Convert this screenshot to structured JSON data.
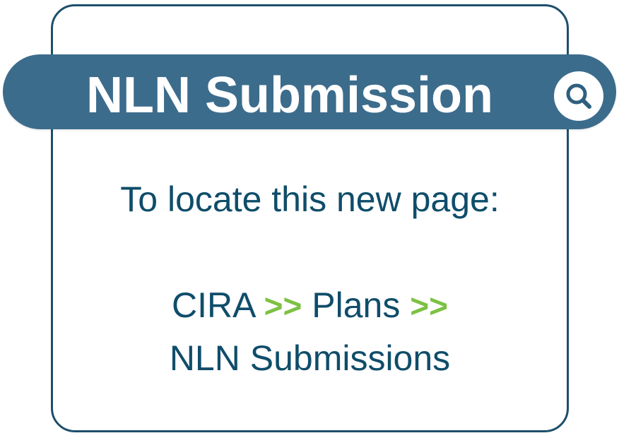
{
  "banner": {
    "title": "NLN Submission",
    "search_icon": "search-icon"
  },
  "instruction": "To locate this new page:",
  "path": {
    "crumb1": "CIRA",
    "sep1": ">>",
    "crumb2": "Plans",
    "sep2": ">>",
    "crumb3": "NLN Submissions"
  },
  "colors": {
    "border": "#1d4f6b",
    "banner": "#3c6c8c",
    "text": "#0f4d6a",
    "separator": "#7dc143"
  }
}
